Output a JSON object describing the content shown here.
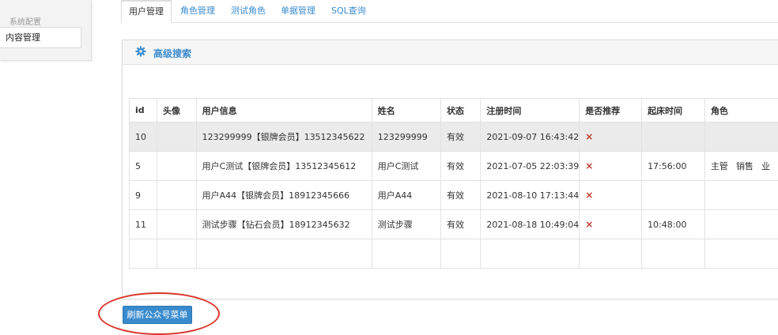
{
  "sidebar": {
    "section_title": "系统配置",
    "items": [
      {
        "label": "内容管理"
      }
    ]
  },
  "tabs": [
    {
      "label": "用户管理",
      "active": true
    },
    {
      "label": "角色管理"
    },
    {
      "label": "测试角色"
    },
    {
      "label": "单据管理"
    },
    {
      "label": "SQL查询"
    }
  ],
  "panel": {
    "title": "高级搜索",
    "icon": "gear-icon"
  },
  "table": {
    "columns": [
      "id",
      "头像",
      "用户信息",
      "姓名",
      "状态",
      "注册时间",
      "是否推荐",
      "起床时间",
      "角色"
    ],
    "rows": [
      {
        "id": "10",
        "avatar": "",
        "info": "123299999【银牌会员】13512345622",
        "name": "123299999",
        "status": "有效",
        "registered": "2021-09-07 16:43:42",
        "recommended": "×",
        "wake": "",
        "roles": []
      },
      {
        "id": "5",
        "avatar": "",
        "info": "用户C测试【银牌会员】13512345612",
        "name": "用户C测试",
        "status": "有效",
        "registered": "2021-07-05 22:03:39",
        "recommended": "×",
        "wake": "17:56:00",
        "roles": [
          "主管",
          "销售",
          "业"
        ]
      },
      {
        "id": "9",
        "avatar": "",
        "info": "用户A44【银牌会员】18912345666",
        "name": "用户A44",
        "status": "有效",
        "registered": "2021-08-10 17:13:44",
        "recommended": "×",
        "wake": "",
        "roles": []
      },
      {
        "id": "11",
        "avatar": "",
        "info": "测试步骤【钻石会员】18912345632",
        "name": "测试步骤",
        "status": "有效",
        "registered": "2021-08-18 10:49:04",
        "recommended": "×",
        "wake": "10:48:00",
        "roles": []
      }
    ]
  },
  "actions": {
    "refresh_label": "刷新公众号菜单"
  },
  "colors": {
    "accent": "#3a8bcd",
    "highlight_ring": "#d9362b",
    "cross": "#c0392b"
  }
}
